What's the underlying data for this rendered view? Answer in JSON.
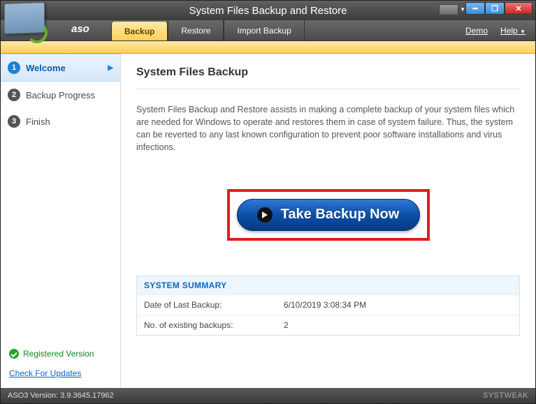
{
  "window": {
    "title": "System Files Backup and Restore"
  },
  "brand": "aso",
  "tabs": {
    "backup": "Backup",
    "restore": "Restore",
    "import": "Import Backup"
  },
  "menu": {
    "demo": "Demo",
    "help": "Help"
  },
  "steps": {
    "items": [
      {
        "num": "1",
        "label": "Welcome"
      },
      {
        "num": "2",
        "label": "Backup Progress"
      },
      {
        "num": "3",
        "label": "Finish"
      }
    ]
  },
  "sidebar": {
    "registered": "Registered Version",
    "check_updates": "Check For Updates"
  },
  "main": {
    "heading": "System Files Backup",
    "description": "System Files Backup and Restore assists in making a complete backup of your system files which are needed for Windows to operate and restores them in case of system failure. Thus, the system can be reverted to any last known configuration to prevent poor software installations and virus infections.",
    "button_label": "Take Backup Now"
  },
  "summary": {
    "title": "SYSTEM SUMMARY",
    "rows": [
      {
        "label": "Date of Last Backup:",
        "value": "6/10/2019 3:08:34 PM"
      },
      {
        "label": "No. of existing backups:",
        "value": "2"
      }
    ]
  },
  "status": {
    "version": "ASO3 Version: 3.9.3645.17962",
    "brand": "SYSTWEAK"
  }
}
